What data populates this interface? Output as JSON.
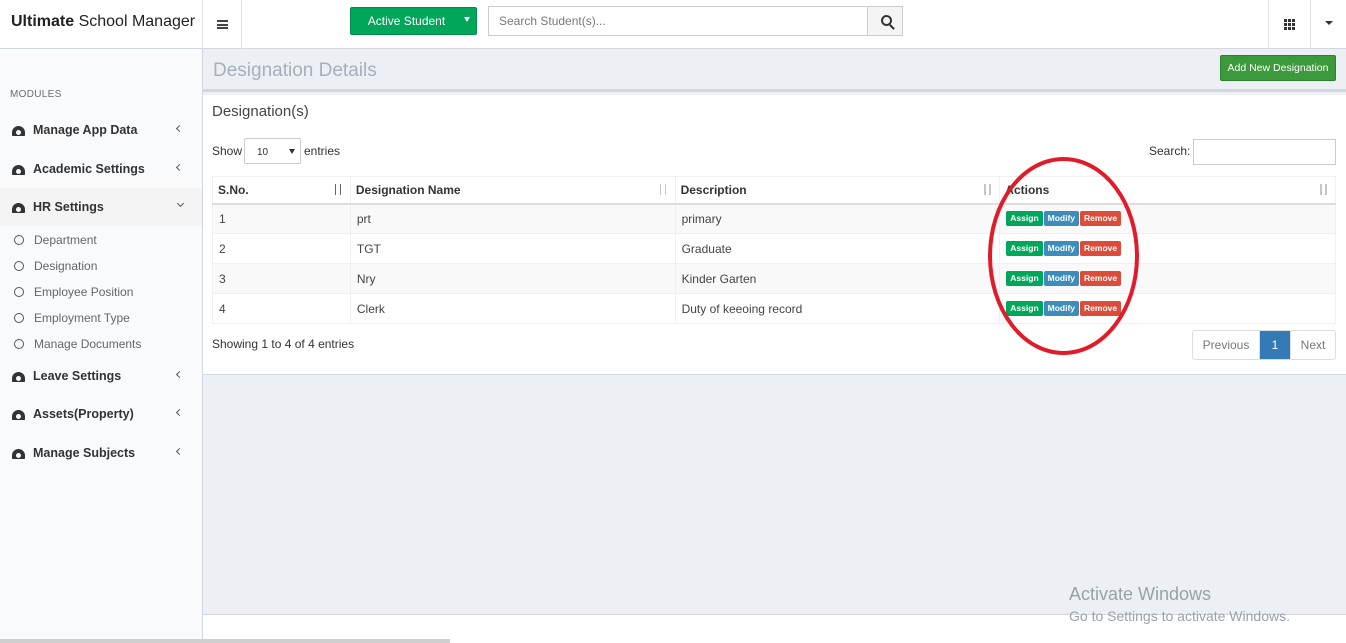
{
  "app": {
    "brand_bold": "Ultimate",
    "brand_rest": " School Manager"
  },
  "topbar": {
    "active_student_label": "Active Student",
    "search_placeholder": "Search Student(s)..."
  },
  "sidebar": {
    "modules_label": "MODULES",
    "items": [
      {
        "label": "Manage App Data"
      },
      {
        "label": "Academic Settings"
      },
      {
        "label": "HR Settings"
      },
      {
        "label": "Leave Settings"
      },
      {
        "label": "Assets(Property)"
      },
      {
        "label": "Manage Subjects"
      }
    ],
    "hr_subitems": [
      {
        "label": "Department"
      },
      {
        "label": "Designation"
      },
      {
        "label": "Employee Position"
      },
      {
        "label": "Employment Type"
      },
      {
        "label": "Manage Documents"
      }
    ]
  },
  "page": {
    "title": "Designation Details",
    "add_button": "Add New Designation",
    "box_title": "Designation(s)",
    "show_label": "Show",
    "entries_value": "10",
    "entries_label": "entries",
    "search_label": "Search:",
    "info": "Showing 1 to 4 of 4 entries"
  },
  "table": {
    "headers": [
      "S.No.",
      "Designation Name",
      "Description",
      "Actions"
    ],
    "rows": [
      {
        "sno": "1",
        "name": "prt",
        "description": "primary"
      },
      {
        "sno": "2",
        "name": "TGT",
        "description": "Graduate"
      },
      {
        "sno": "3",
        "name": "Nry",
        "description": "Kinder Garten"
      },
      {
        "sno": "4",
        "name": "Clerk",
        "description": "Duty of keeoing record"
      }
    ],
    "actions": {
      "assign": "Assign",
      "modify": "Modify",
      "remove": "Remove"
    }
  },
  "pagination": {
    "previous": "Previous",
    "current": "1",
    "next": "Next"
  },
  "watermark": {
    "title": "Activate Windows",
    "subtitle": "Go to Settings to activate Windows."
  },
  "colors": {
    "green": "#00a65a",
    "blue": "#3c8dbc",
    "red": "#dd4b39",
    "annotation_ellipse": "#e01b2a"
  }
}
